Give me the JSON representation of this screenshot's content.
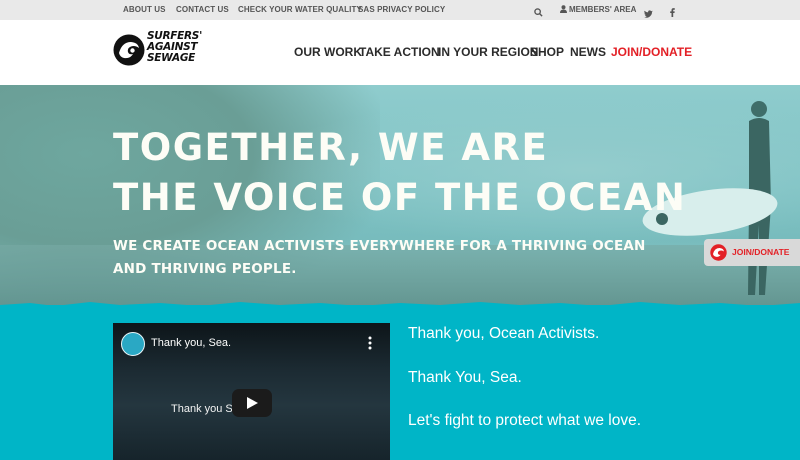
{
  "topbar": {
    "links": [
      "ABOUT US",
      "CONTACT US",
      "CHECK YOUR WATER QUALITY",
      "SAS PRIVACY POLICY"
    ],
    "members": "MEMBERS' AREA",
    "icons": [
      "search-icon",
      "user-icon",
      "twitter-icon",
      "facebook-icon"
    ]
  },
  "logo": {
    "line1": "SURFERS'",
    "line2": "AGAINST",
    "line3": "SEWAGE"
  },
  "nav": {
    "items": [
      "OUR WORK",
      "TAKE ACTION",
      "IN YOUR REGION",
      "SHOP",
      "NEWS"
    ],
    "join": "JOIN/DONATE"
  },
  "hero": {
    "title_line1": "TOGETHER, WE ARE",
    "title_line2": "THE VOICE OF THE OCEAN",
    "subtitle": "WE CREATE OCEAN ACTIVISTS EVERYWHERE FOR A THRIVING OCEAN AND THRIVING PEOPLE."
  },
  "side_join": {
    "label": "JOIN/DONATE"
  },
  "video": {
    "title": "Thank you, Sea.",
    "caption": "Thank you Sea."
  },
  "message": {
    "line1": "Thank you, Ocean Activists.",
    "line2": "Thank You, Sea.",
    "line3": "Let's fight to protect what we love."
  },
  "colors": {
    "accent_red": "#e32026",
    "teal": "#00b5c7",
    "topbar": "#e9e9e9"
  }
}
